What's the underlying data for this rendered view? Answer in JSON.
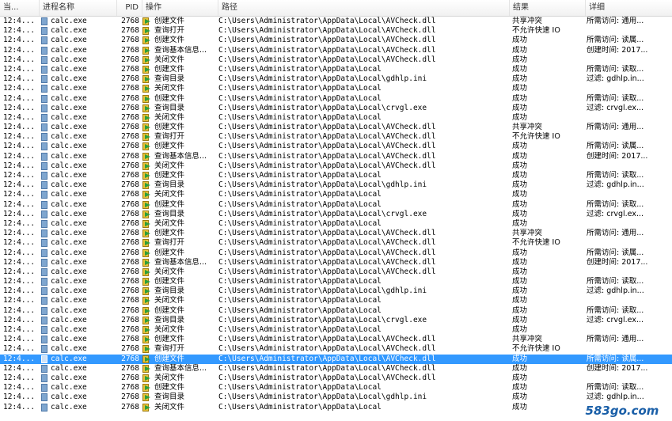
{
  "columns": {
    "time": "当...",
    "process": "进程名称",
    "pid": "PID",
    "operation": "操作",
    "path": "路径",
    "result": "结果",
    "detail": "详细"
  },
  "colors": {
    "selection": "#3399ff",
    "icon_green": "#2e9e3a",
    "icon_yellow": "#e8c23a"
  },
  "rows": [
    {
      "time": "12:4...",
      "process": "calc.exe",
      "pid": "2768",
      "op": "创建文件",
      "path": "C:\\Users\\Administrator\\AppData\\Local\\AVCheck.dll",
      "result": "共享冲突",
      "detail": "所需访问: 通用..."
    },
    {
      "time": "12:4...",
      "process": "calc.exe",
      "pid": "2768",
      "op": "查询打开",
      "path": "C:\\Users\\Administrator\\AppData\\Local\\AVCheck.dll",
      "result": "不允许快速 IO",
      "detail": ""
    },
    {
      "time": "12:4...",
      "process": "calc.exe",
      "pid": "2768",
      "op": "创建文件",
      "path": "C:\\Users\\Administrator\\AppData\\Local\\AVCheck.dll",
      "result": "成功",
      "detail": "所需访问: 读属..."
    },
    {
      "time": "12:4...",
      "process": "calc.exe",
      "pid": "2768",
      "op": "查询基本信息...",
      "path": "C:\\Users\\Administrator\\AppData\\Local\\AVCheck.dll",
      "result": "成功",
      "detail": "创建时间: 2017..."
    },
    {
      "time": "12:4...",
      "process": "calc.exe",
      "pid": "2768",
      "op": "关闭文件",
      "path": "C:\\Users\\Administrator\\AppData\\Local\\AVCheck.dll",
      "result": "成功",
      "detail": ""
    },
    {
      "time": "12:4...",
      "process": "calc.exe",
      "pid": "2768",
      "op": "创建文件",
      "path": "C:\\Users\\Administrator\\AppData\\Local",
      "result": "成功",
      "detail": "所需访问: 读取..."
    },
    {
      "time": "12:4...",
      "process": "calc.exe",
      "pid": "2768",
      "op": "查询目录",
      "path": "C:\\Users\\Administrator\\AppData\\Local\\gdhlp.ini",
      "result": "成功",
      "detail": "过滤: gdhlp.in..."
    },
    {
      "time": "12:4...",
      "process": "calc.exe",
      "pid": "2768",
      "op": "关闭文件",
      "path": "C:\\Users\\Administrator\\AppData\\Local",
      "result": "成功",
      "detail": ""
    },
    {
      "time": "12:4...",
      "process": "calc.exe",
      "pid": "2768",
      "op": "创建文件",
      "path": "C:\\Users\\Administrator\\AppData\\Local",
      "result": "成功",
      "detail": "所需访问: 读取..."
    },
    {
      "time": "12:4...",
      "process": "calc.exe",
      "pid": "2768",
      "op": "查询目录",
      "path": "C:\\Users\\Administrator\\AppData\\Local\\crvgl.exe",
      "result": "成功",
      "detail": "过滤: crvgl.ex..."
    },
    {
      "time": "12:4...",
      "process": "calc.exe",
      "pid": "2768",
      "op": "关闭文件",
      "path": "C:\\Users\\Administrator\\AppData\\Local",
      "result": "成功",
      "detail": ""
    },
    {
      "time": "12:4...",
      "process": "calc.exe",
      "pid": "2768",
      "op": "创建文件",
      "path": "C:\\Users\\Administrator\\AppData\\Local\\AVCheck.dll",
      "result": "共享冲突",
      "detail": "所需访问: 通用..."
    },
    {
      "time": "12:4...",
      "process": "calc.exe",
      "pid": "2768",
      "op": "查询打开",
      "path": "C:\\Users\\Administrator\\AppData\\Local\\AVCheck.dll",
      "result": "不允许快速 IO",
      "detail": ""
    },
    {
      "time": "12:4...",
      "process": "calc.exe",
      "pid": "2768",
      "op": "创建文件",
      "path": "C:\\Users\\Administrator\\AppData\\Local\\AVCheck.dll",
      "result": "成功",
      "detail": "所需访问: 读属..."
    },
    {
      "time": "12:4...",
      "process": "calc.exe",
      "pid": "2768",
      "op": "查询基本信息...",
      "path": "C:\\Users\\Administrator\\AppData\\Local\\AVCheck.dll",
      "result": "成功",
      "detail": "创建时间: 2017..."
    },
    {
      "time": "12:4...",
      "process": "calc.exe",
      "pid": "2768",
      "op": "关闭文件",
      "path": "C:\\Users\\Administrator\\AppData\\Local\\AVCheck.dll",
      "result": "成功",
      "detail": ""
    },
    {
      "time": "12:4...",
      "process": "calc.exe",
      "pid": "2768",
      "op": "创建文件",
      "path": "C:\\Users\\Administrator\\AppData\\Local",
      "result": "成功",
      "detail": "所需访问: 读取..."
    },
    {
      "time": "12:4...",
      "process": "calc.exe",
      "pid": "2768",
      "op": "查询目录",
      "path": "C:\\Users\\Administrator\\AppData\\Local\\gdhlp.ini",
      "result": "成功",
      "detail": "过滤: gdhlp.in..."
    },
    {
      "time": "12:4...",
      "process": "calc.exe",
      "pid": "2768",
      "op": "关闭文件",
      "path": "C:\\Users\\Administrator\\AppData\\Local",
      "result": "成功",
      "detail": ""
    },
    {
      "time": "12:4...",
      "process": "calc.exe",
      "pid": "2768",
      "op": "创建文件",
      "path": "C:\\Users\\Administrator\\AppData\\Local",
      "result": "成功",
      "detail": "所需访问: 读取..."
    },
    {
      "time": "12:4...",
      "process": "calc.exe",
      "pid": "2768",
      "op": "查询目录",
      "path": "C:\\Users\\Administrator\\AppData\\Local\\crvgl.exe",
      "result": "成功",
      "detail": "过滤: crvgl.ex..."
    },
    {
      "time": "12:4...",
      "process": "calc.exe",
      "pid": "2768",
      "op": "关闭文件",
      "path": "C:\\Users\\Administrator\\AppData\\Local",
      "result": "成功",
      "detail": ""
    },
    {
      "time": "12:4...",
      "process": "calc.exe",
      "pid": "2768",
      "op": "创建文件",
      "path": "C:\\Users\\Administrator\\AppData\\Local\\AVCheck.dll",
      "result": "共享冲突",
      "detail": "所需访问: 通用..."
    },
    {
      "time": "12:4...",
      "process": "calc.exe",
      "pid": "2768",
      "op": "查询打开",
      "path": "C:\\Users\\Administrator\\AppData\\Local\\AVCheck.dll",
      "result": "不允许快速 IO",
      "detail": ""
    },
    {
      "time": "12:4...",
      "process": "calc.exe",
      "pid": "2768",
      "op": "创建文件",
      "path": "C:\\Users\\Administrator\\AppData\\Local\\AVCheck.dll",
      "result": "成功",
      "detail": "所需访问: 读属..."
    },
    {
      "time": "12:4...",
      "process": "calc.exe",
      "pid": "2768",
      "op": "查询基本信息...",
      "path": "C:\\Users\\Administrator\\AppData\\Local\\AVCheck.dll",
      "result": "成功",
      "detail": "创建时间: 2017..."
    },
    {
      "time": "12:4...",
      "process": "calc.exe",
      "pid": "2768",
      "op": "关闭文件",
      "path": "C:\\Users\\Administrator\\AppData\\Local\\AVCheck.dll",
      "result": "成功",
      "detail": ""
    },
    {
      "time": "12:4...",
      "process": "calc.exe",
      "pid": "2768",
      "op": "创建文件",
      "path": "C:\\Users\\Administrator\\AppData\\Local",
      "result": "成功",
      "detail": "所需访问: 读取..."
    },
    {
      "time": "12:4...",
      "process": "calc.exe",
      "pid": "2768",
      "op": "查询目录",
      "path": "C:\\Users\\Administrator\\AppData\\Local\\gdhlp.ini",
      "result": "成功",
      "detail": "过滤: gdhlp.in..."
    },
    {
      "time": "12:4...",
      "process": "calc.exe",
      "pid": "2768",
      "op": "关闭文件",
      "path": "C:\\Users\\Administrator\\AppData\\Local",
      "result": "成功",
      "detail": ""
    },
    {
      "time": "12:4...",
      "process": "calc.exe",
      "pid": "2768",
      "op": "创建文件",
      "path": "C:\\Users\\Administrator\\AppData\\Local",
      "result": "成功",
      "detail": "所需访问: 读取..."
    },
    {
      "time": "12:4...",
      "process": "calc.exe",
      "pid": "2768",
      "op": "查询目录",
      "path": "C:\\Users\\Administrator\\AppData\\Local\\crvgl.exe",
      "result": "成功",
      "detail": "过滤: crvgl.ex..."
    },
    {
      "time": "12:4...",
      "process": "calc.exe",
      "pid": "2768",
      "op": "关闭文件",
      "path": "C:\\Users\\Administrator\\AppData\\Local",
      "result": "成功",
      "detail": ""
    },
    {
      "time": "12:4...",
      "process": "calc.exe",
      "pid": "2768",
      "op": "创建文件",
      "path": "C:\\Users\\Administrator\\AppData\\Local\\AVCheck.dll",
      "result": "共享冲突",
      "detail": "所需访问: 通用..."
    },
    {
      "time": "12:4...",
      "process": "calc.exe",
      "pid": "2768",
      "op": "查询打开",
      "path": "C:\\Users\\Administrator\\AppData\\Local\\AVCheck.dll",
      "result": "不允许快速 IO",
      "detail": ""
    },
    {
      "time": "12:4...",
      "process": "calc.exe",
      "pid": "2768",
      "op": "创建文件",
      "path": "C:\\Users\\Administrator\\AppData\\Local\\AVCheck.dll",
      "result": "成功",
      "detail": "所需访问: 读属...",
      "selected": true
    },
    {
      "time": "12:4...",
      "process": "calc.exe",
      "pid": "2768",
      "op": "查询基本信息...",
      "path": "C:\\Users\\Administrator\\AppData\\Local\\AVCheck.dll",
      "result": "成功",
      "detail": "创建时间: 2017..."
    },
    {
      "time": "12:4...",
      "process": "calc.exe",
      "pid": "2768",
      "op": "关闭文件",
      "path": "C:\\Users\\Administrator\\AppData\\Local\\AVCheck.dll",
      "result": "成功",
      "detail": ""
    },
    {
      "time": "12:4...",
      "process": "calc.exe",
      "pid": "2768",
      "op": "创建文件",
      "path": "C:\\Users\\Administrator\\AppData\\Local",
      "result": "成功",
      "detail": "所需访问: 读取..."
    },
    {
      "time": "12:4...",
      "process": "calc.exe",
      "pid": "2768",
      "op": "查询目录",
      "path": "C:\\Users\\Administrator\\AppData\\Local\\gdhlp.ini",
      "result": "成功",
      "detail": "过滤: gdhlp.in..."
    },
    {
      "time": "12:4...",
      "process": "calc.exe",
      "pid": "2768",
      "op": "关闭文件",
      "path": "C:\\Users\\Administrator\\AppData\\Local",
      "result": "成功",
      "detail": ""
    }
  ],
  "watermark": "583go.com"
}
